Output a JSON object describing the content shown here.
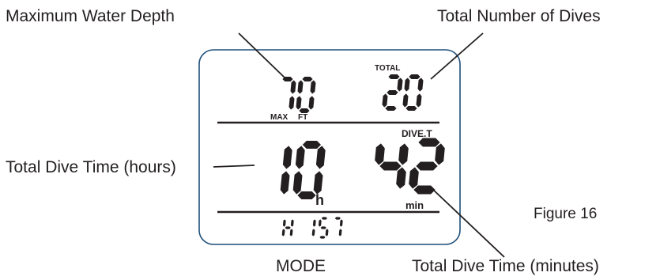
{
  "callouts": {
    "max_depth": "Maximum Water Depth",
    "total_dives": "Total Number of Dives",
    "dive_time_hours": "Total Dive Time (hours)",
    "dive_time_minutes": "Total Dive Time (minutes)",
    "mode": "MODE",
    "figure": "Figure 16"
  },
  "lcd": {
    "max_depth_value": "70",
    "max_label": "MAX",
    "unit_label": "FT",
    "total_label": "TOTAL",
    "total_dives_value": "20",
    "dive_t_label": "DIVE.T",
    "hours_value": "10",
    "hours_unit": "h",
    "minutes_value": "42",
    "minutes_unit": "min",
    "mode_text": "H 1ST"
  },
  "colors": {
    "ink": "#231f20",
    "panel_border": "#1f4f7a",
    "panel_fill": "#ffffff"
  }
}
